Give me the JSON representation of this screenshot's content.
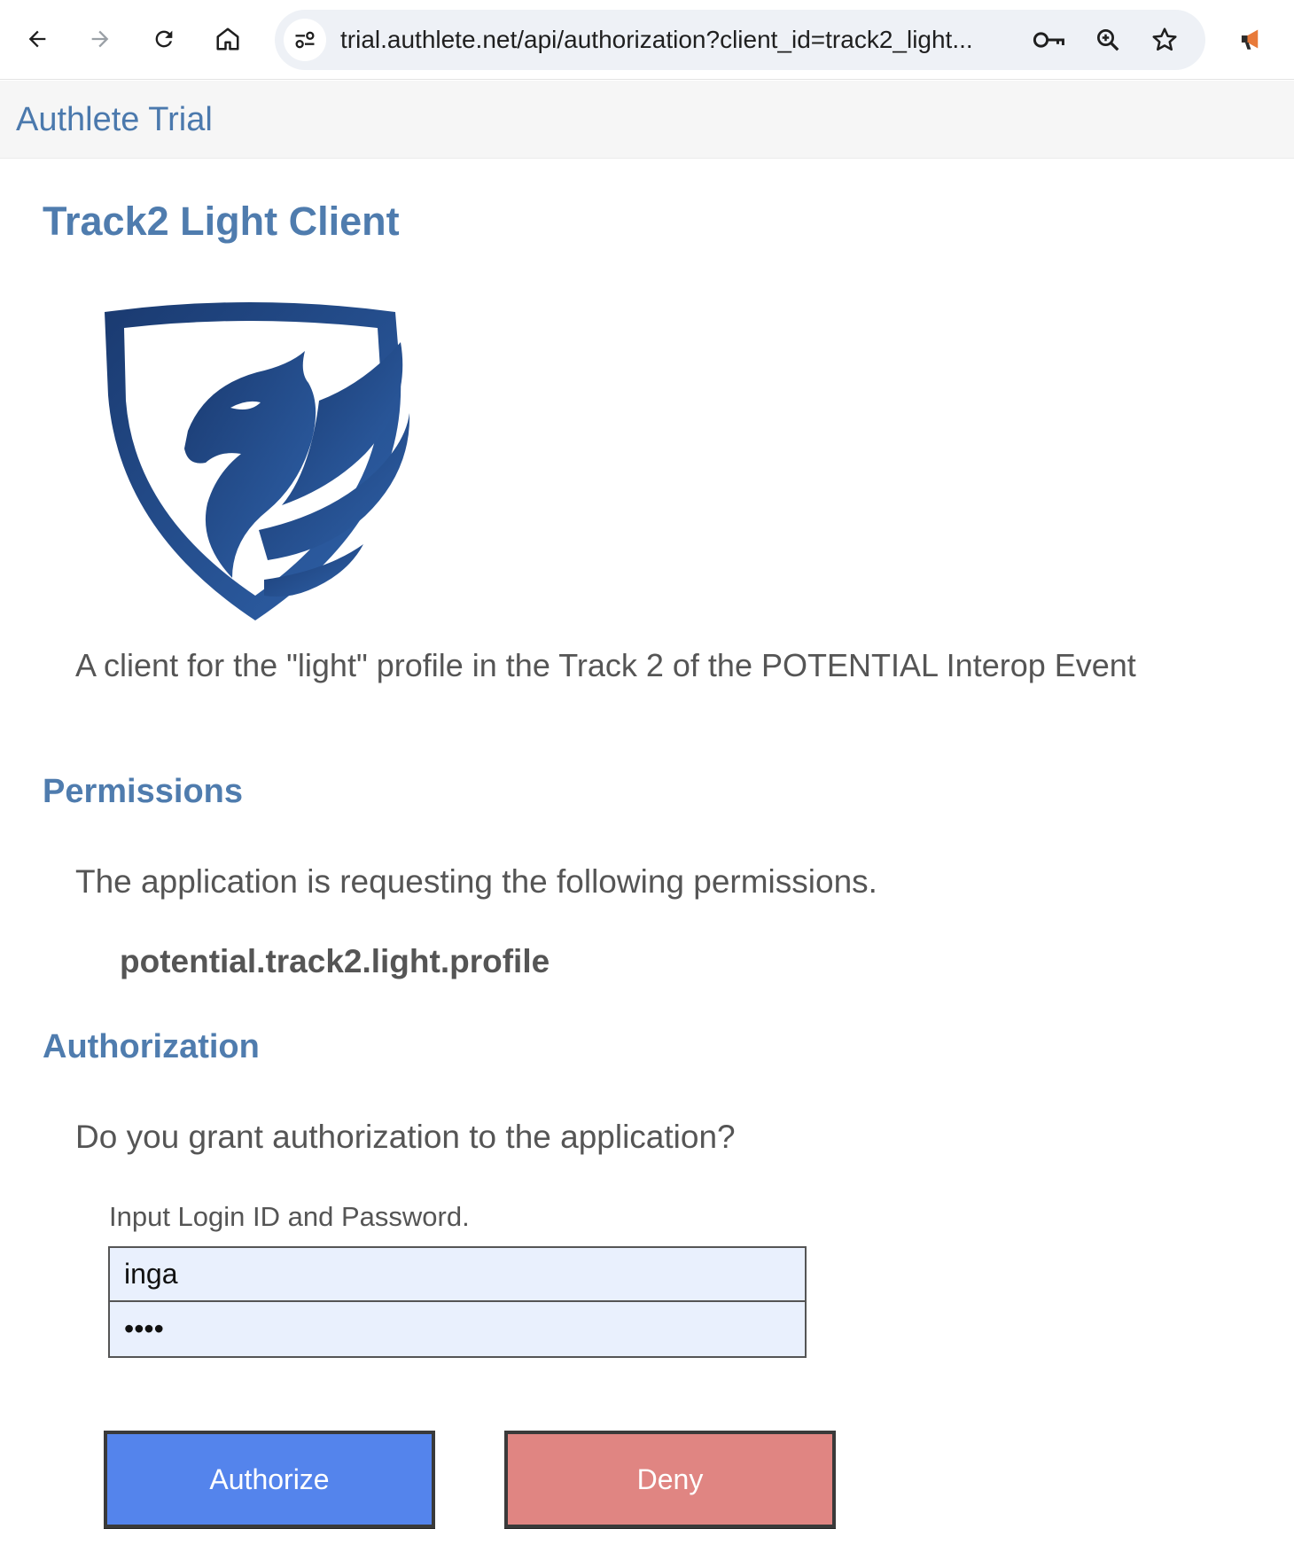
{
  "browser": {
    "url": "trial.authlete.net/api/authorization?client_id=track2_light...",
    "icons": [
      "back-icon",
      "forward-icon",
      "reload-icon",
      "home-icon",
      "site-info-icon",
      "password-key-icon",
      "zoom-icon",
      "bookmark-star-icon",
      "megaphone-icon"
    ]
  },
  "site": {
    "brand": "Authlete Trial"
  },
  "client": {
    "name": "Track2 Light Client",
    "description": "A client for the \"light\" profile in the Track 2 of the POTENTIAL Interop Event"
  },
  "permissions": {
    "heading": "Permissions",
    "intro": "The application is requesting the following permissions.",
    "scopes": [
      "potential.track2.light.profile"
    ]
  },
  "authorization": {
    "heading": "Authorization",
    "question": "Do you grant authorization to the application?",
    "login_label": "Input Login ID and Password.",
    "login_id": "inga",
    "password": "inga",
    "authorize_label": "Authorize",
    "deny_label": "Deny"
  },
  "colors": {
    "heading": "#4f7cae",
    "authorize_button": "#5484ec",
    "deny_button": "#e08582",
    "input_background": "#e9f0fd"
  }
}
